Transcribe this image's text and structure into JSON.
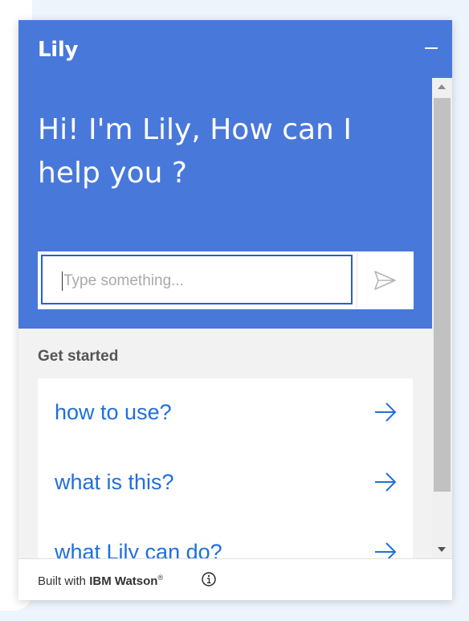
{
  "header": {
    "title": "Lily"
  },
  "hero": {
    "greeting": "Hi! I'm Lily, How can I help you ?"
  },
  "input": {
    "placeholder": "Type something..."
  },
  "get_started": {
    "heading": "Get started",
    "items": [
      {
        "label": "how to use?"
      },
      {
        "label": "what is this?"
      },
      {
        "label": "what Lily can do?"
      }
    ]
  },
  "footer": {
    "prefix": "Built with ",
    "brand": "IBM Watson",
    "reg": "®"
  },
  "icons": {
    "minimize": "minimize-icon",
    "send": "send-icon",
    "arrow": "arrow-right-icon",
    "info": "info-icon"
  },
  "colors": {
    "primary": "#4878da",
    "link": "#1f6fdc",
    "panel": "#f2f2f2"
  }
}
